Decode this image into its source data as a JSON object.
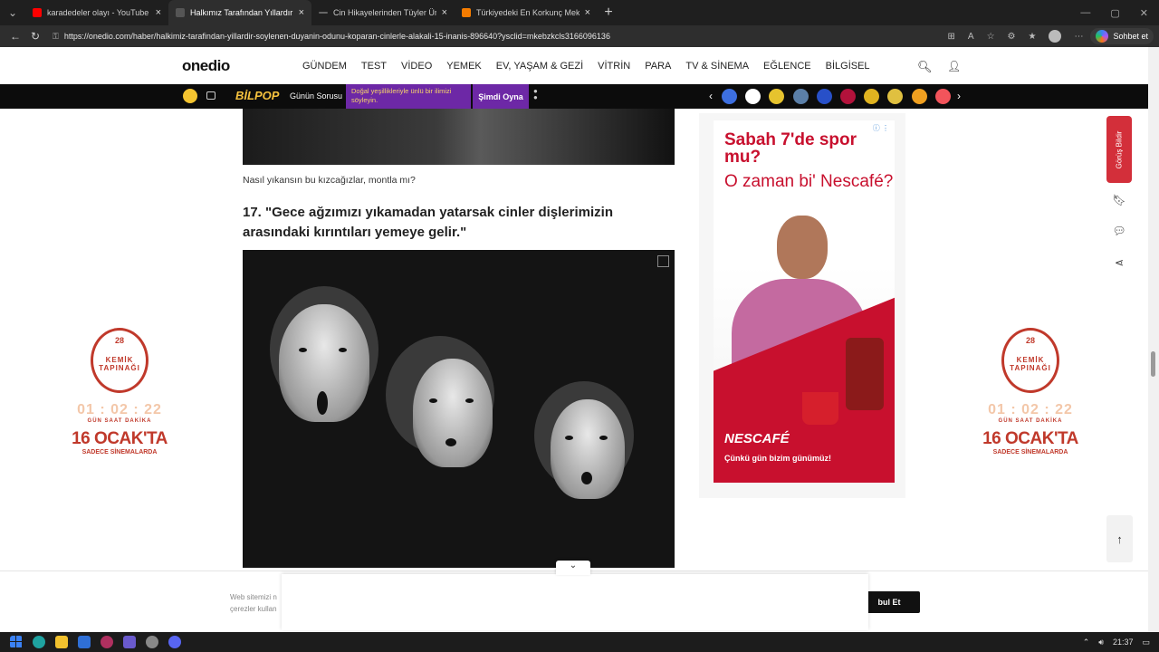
{
  "browser": {
    "tabs": [
      {
        "label": "karadedeler olayı - YouTube",
        "color": "#ff0000",
        "active": false
      },
      {
        "label": "Halkımız Tarafından Yıllardır Söyle",
        "color": "#444444",
        "active": true
      },
      {
        "label": "Cin Hikayelerinden Tüyler Ürperte",
        "color": "#666666",
        "active": false
      },
      {
        "label": "Türkiyedeki En Korkunç Mekanlar",
        "color": "#f57c00",
        "active": false
      }
    ],
    "url": "https://onedio.com/haber/halkimiz-tarafindan-yillardir-soylenen-duyanin-odunu-koparan-cinlerle-alakali-15-inanis-896640?ysclid=mkebzkcls3166096136",
    "copilot_label": "Sohbet et"
  },
  "site": {
    "brand": "onedio",
    "nav": [
      "GÜNDEM",
      "TEST",
      "VİDEO",
      "YEMEK",
      "EV, YAŞAM & GEZİ",
      "VİTRİN",
      "PARA",
      "TV & SİNEMA",
      "EĞLENCE",
      "BİLGİSEL"
    ]
  },
  "ticker": {
    "bilpop": "BİLPOP",
    "question_label": "Günün Sorusu",
    "question": "Doğal yeşillikleriyle ünlü bir ilimizi söyleyin.",
    "play": "Şimdi Oyna",
    "story_colors": [
      "#3d6fe0",
      "#ffffff",
      "#e6c32e",
      "#5b7fa8",
      "#2850c8",
      "#b2123b",
      "#e0b320",
      "#e0c040",
      "#f0a020",
      "#f2545b"
    ]
  },
  "side_ad": {
    "number": "28",
    "title": "KEMİK TAPINAĞI",
    "timer": "01 : 02 : 22",
    "timer_labels": "GÜN SAAT DAKİKA",
    "date": "16 OCAK'TA",
    "cinema": "SADECE SİNEMALARDA"
  },
  "article": {
    "caption": "Nasıl yıkansın bu kızcağızlar, montla mı?",
    "heading": "17. \"Gece ağzımızı yıkamadan yatarsak cinler dişlerimizin arasındaki kırıntıları yemeye gelir.\""
  },
  "ad": {
    "headline1": "Sabah 7'de spor mu?",
    "headline2": "O zaman bi' Nescafé?",
    "brand": "NESCAFÉ",
    "tagline": "Çünkü gün bizim günümüz!"
  },
  "feedback": "Görüş Bildir",
  "cookie": {
    "text_line1": "Web sitemizi n",
    "text_line2": "çerezler kullan",
    "accept": "bul Et"
  },
  "taskbar": {
    "time": "21:37"
  }
}
